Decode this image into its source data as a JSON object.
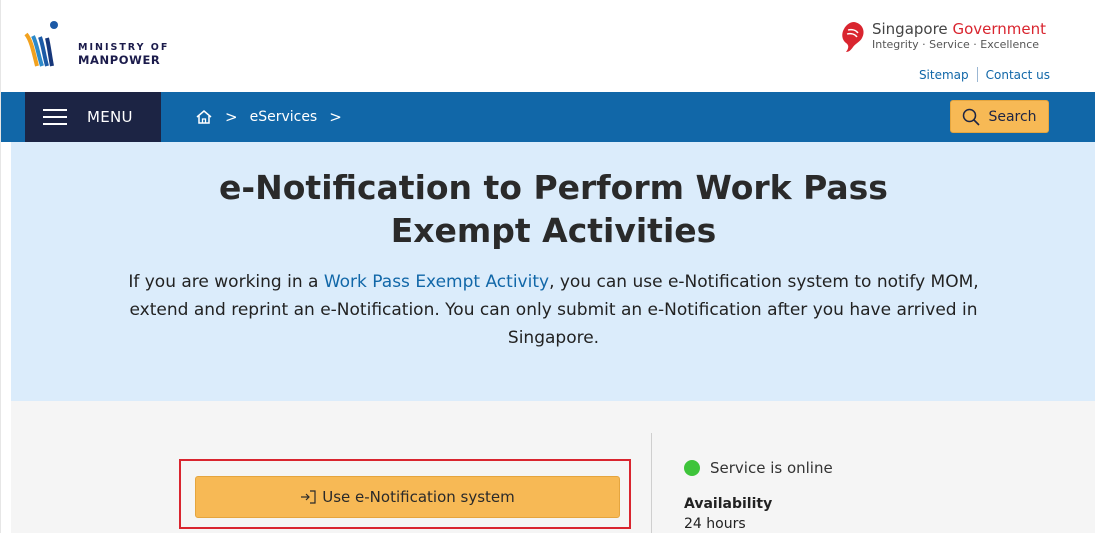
{
  "header": {
    "mom_logo_line1": "MINISTRY OF",
    "mom_logo_line2": "MANPOWER",
    "sg_title_part1": "Singapore",
    "sg_title_part2": "Government",
    "sg_tagline": "Integrity · Service · Excellence",
    "util_links": {
      "sitemap": "Sitemap",
      "contact": "Contact us"
    }
  },
  "nav": {
    "menu_label": "MENU",
    "breadcrumb": {
      "current": "eServices",
      "separator": ">"
    },
    "search_label": "Search"
  },
  "hero": {
    "title": "e-Notification to Perform Work Pass Exempt Activities",
    "intro_before": "If you are working in a ",
    "intro_link": "Work Pass Exempt Activity",
    "intro_after": ", you can use e-Notification system to notify MOM, extend and reprint an e-Notification. You can only submit an e-Notification after you have arrived in Singapore."
  },
  "service": {
    "cta_label": "Use e-Notification system",
    "status_text": "Service is online",
    "availability_title": "Availability",
    "availability_value": "24 hours"
  },
  "colors": {
    "nav_blue": "#1167a8",
    "menu_dark": "#1c2444",
    "accent_orange": "#f7b955",
    "hero_bg": "#dbecfb",
    "status_green": "#3ec43a",
    "highlight_red": "#d9252f"
  }
}
